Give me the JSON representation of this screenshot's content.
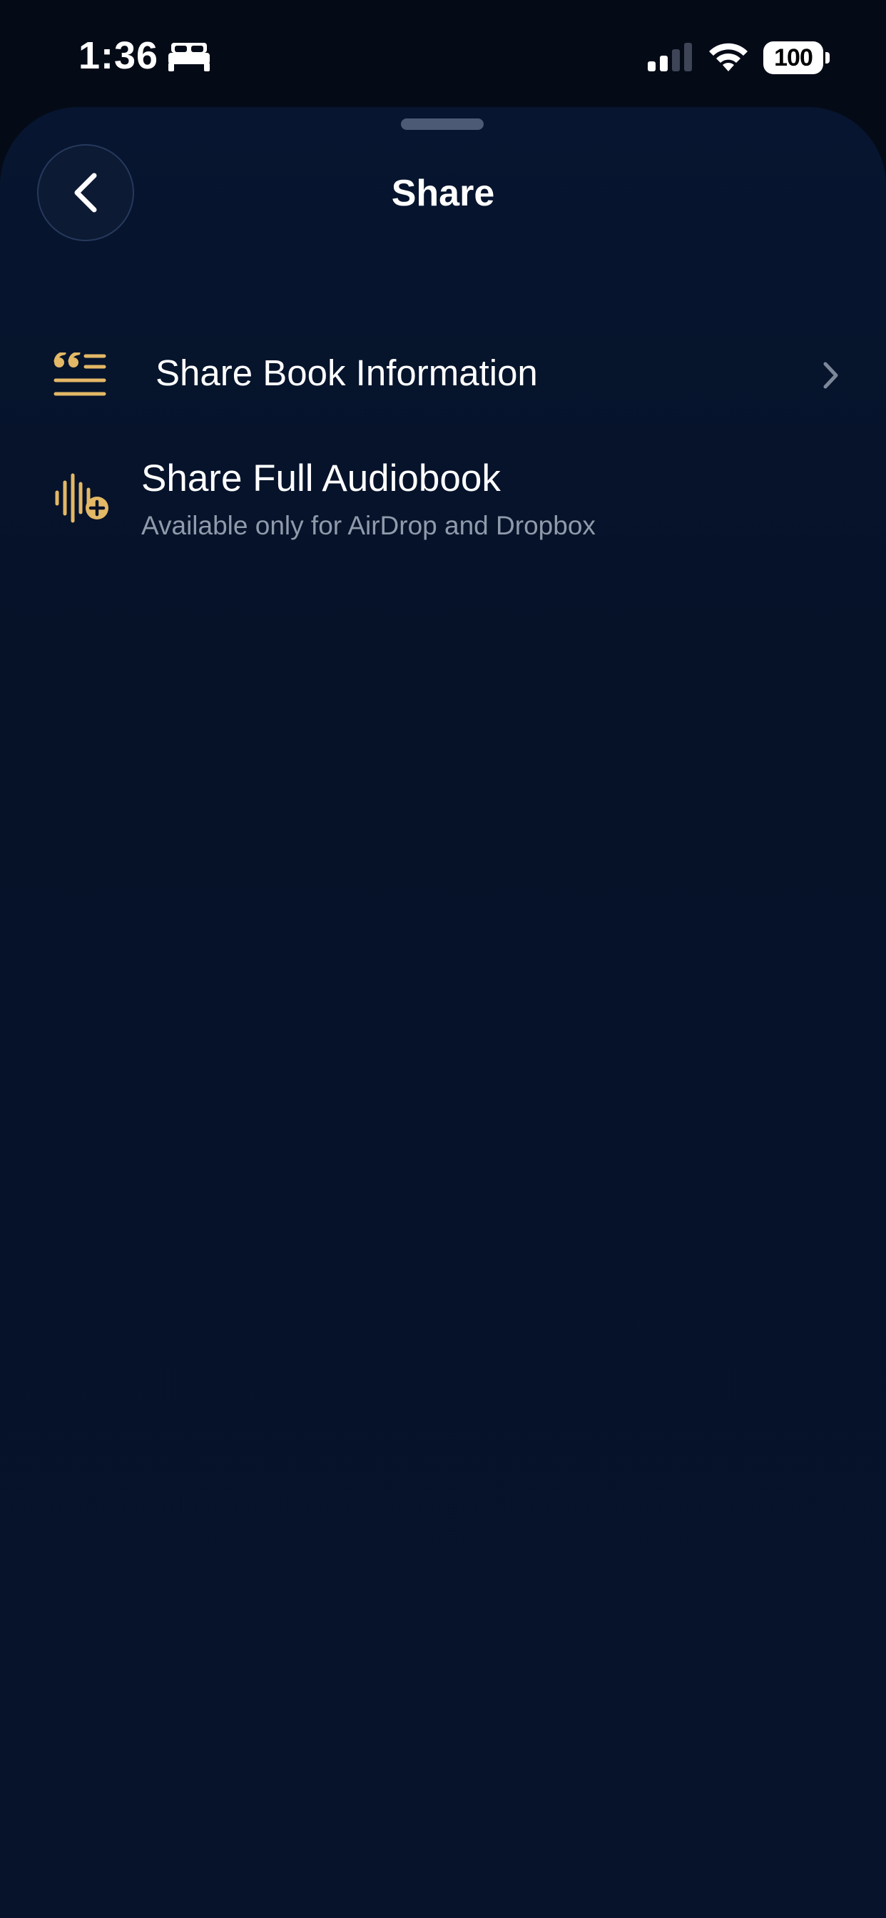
{
  "status_bar": {
    "time": "1:36",
    "battery": "100",
    "sleep_icon": "bed-icon",
    "signal_icon": "cellular-signal-icon",
    "wifi_icon": "wifi-icon"
  },
  "sheet": {
    "title": "Share",
    "back_icon": "chevron-left-icon"
  },
  "options": [
    {
      "icon": "quote-lines-icon",
      "label": "Share Book Information",
      "trailing_icon": "chevron-right-icon"
    },
    {
      "icon": "waveform-plus-icon",
      "label": "Share Full Audiobook",
      "sublabel": "Available only for AirDrop and Dropbox"
    }
  ],
  "colors": {
    "background": "#040b17",
    "sheet": "#071530",
    "accent_gold": "#e3b866",
    "secondary_text": "#8f9aab"
  }
}
